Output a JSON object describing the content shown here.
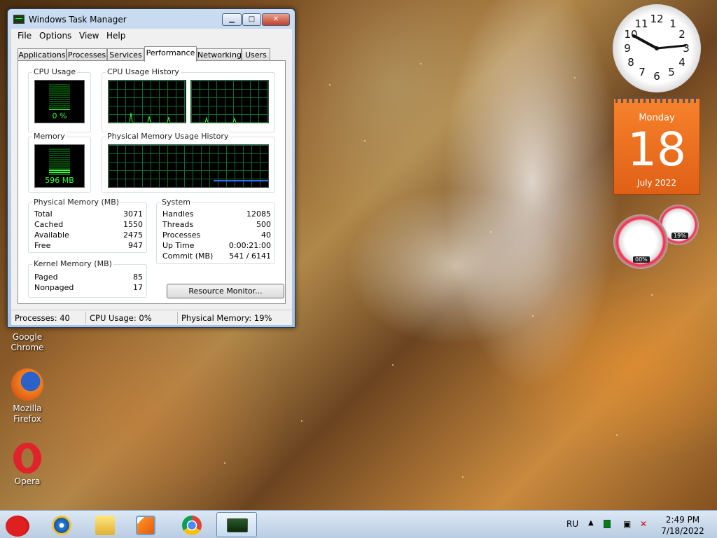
{
  "window": {
    "title": "Windows Task Manager",
    "min_label": "▁",
    "max_label": "□",
    "close_label": "✕"
  },
  "menu": [
    "File",
    "Options",
    "View",
    "Help"
  ],
  "tabs": [
    "Applications",
    "Processes",
    "Services",
    "Performance",
    "Networking",
    "Users"
  ],
  "active_tab": "Performance",
  "panels": {
    "cpu_usage_label": "CPU Usage",
    "cpu_usage_value": "0 %",
    "cpu_fill_fraction": 0.0,
    "cpu_history_label": "CPU Usage History",
    "memory_label": "Memory",
    "memory_value": "596 MB",
    "memory_fill_fraction": 0.19,
    "mem_history_label": "Physical Memory Usage History"
  },
  "physical_memory": {
    "label": "Physical Memory (MB)",
    "rows": [
      {
        "name": "Total",
        "value": "3071"
      },
      {
        "name": "Cached",
        "value": "1550"
      },
      {
        "name": "Available",
        "value": "2475"
      },
      {
        "name": "Free",
        "value": "947"
      }
    ]
  },
  "kernel_memory": {
    "label": "Kernel Memory (MB)",
    "rows": [
      {
        "name": "Paged",
        "value": "85"
      },
      {
        "name": "Nonpaged",
        "value": "17"
      }
    ]
  },
  "system": {
    "label": "System",
    "rows": [
      {
        "name": "Handles",
        "value": "12085"
      },
      {
        "name": "Threads",
        "value": "500"
      },
      {
        "name": "Processes",
        "value": "40"
      },
      {
        "name": "Up Time",
        "value": "0:00:21:00"
      },
      {
        "name": "Commit (MB)",
        "value": "541 / 6141"
      }
    ]
  },
  "resource_monitor_label": "Resource Monitor...",
  "status": {
    "processes": "Processes: 40",
    "cpu": "CPU Usage: 0%",
    "memory": "Physical Memory: 19%"
  },
  "desktop_icons": [
    {
      "label1": "Google",
      "label2": "Chrome",
      "icon": "chrome-icon"
    },
    {
      "label1": "Mozilla",
      "label2": "Firefox",
      "icon": "firefox-icon"
    },
    {
      "label1": "Opera",
      "label2": "",
      "icon": "opera-icon"
    }
  ],
  "gadgets": {
    "clock_numbers": [
      "12",
      "1",
      "2",
      "3",
      "4",
      "5",
      "6",
      "7",
      "8",
      "9",
      "10",
      "11"
    ],
    "calendar_day": "Monday",
    "calendar_date": "18",
    "calendar_month": "July 2022",
    "cpu_meter_value": "00%",
    "mem_meter_value": "19%"
  },
  "taskbar": {
    "lang": "RU",
    "time": "2:49 PM",
    "date": "7/18/2022",
    "apps": [
      "angry-birds-icon",
      "internet-explorer-icon",
      "explorer-folder-icon",
      "media-player-icon",
      "chrome-icon",
      "task-manager-icon"
    ]
  },
  "colors": {
    "graph_grid": "#0b6b2f",
    "graph_line": "#3cff3c",
    "mem_line": "#2f6fff",
    "calendar_orange": "#f07020"
  }
}
